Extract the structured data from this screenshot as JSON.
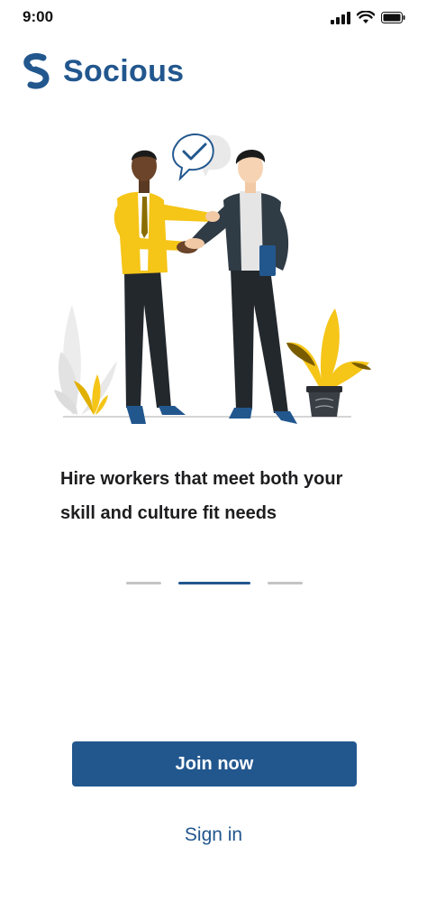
{
  "status_bar": {
    "time": "9:00",
    "icons": [
      "signal-icon",
      "wifi-icon",
      "battery-icon"
    ]
  },
  "brand": {
    "name": "Socious",
    "logo_icon": "socious-logo-icon",
    "color": "#22578e"
  },
  "onboarding": {
    "headline_line1": "Hire workers that meet both your",
    "headline_line2": "skill and culture fit needs",
    "page_count": 3,
    "active_page": 2
  },
  "actions": {
    "join_label": "Join now",
    "signin_label": "Sign in"
  },
  "colors": {
    "primary": "#22578e",
    "accent": "#f5c518",
    "pager_inactive": "#c4c4c4"
  }
}
